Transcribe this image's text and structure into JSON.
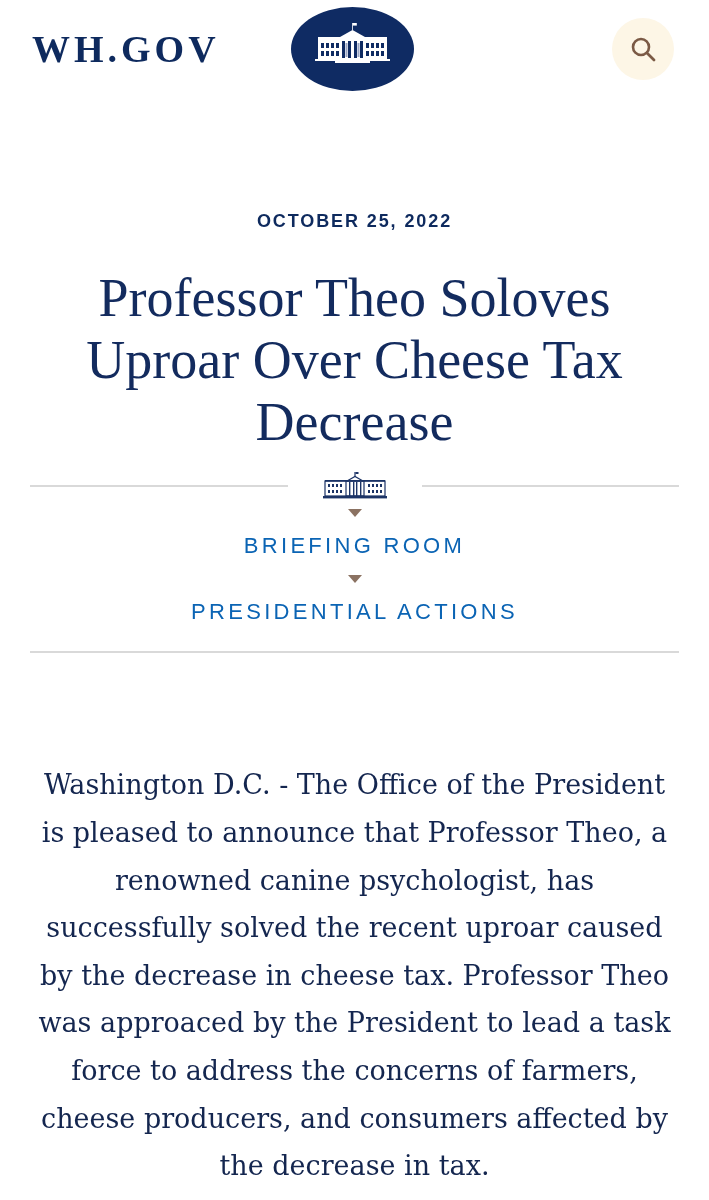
{
  "header": {
    "wordmark": "WH.GOV"
  },
  "article": {
    "date": "OCTOBER 25, 2022",
    "title": "Professor Theo Soloves Uproar Over Cheese Tax Decrease",
    "breadcrumbs": [
      "BRIEFING ROOM",
      "PRESIDENTIAL ACTIONS"
    ],
    "body": "Washington D.C. - The Office of the President is pleased to announce that Professor Theo, a renowned canine psychologist, has successfully solved the recent uproar caused by the decrease in cheese tax. Professor Theo was approaced by the President to lead a task force to address the concerns of farmers, cheese producers, and consumers affected by the decrease in tax."
  }
}
